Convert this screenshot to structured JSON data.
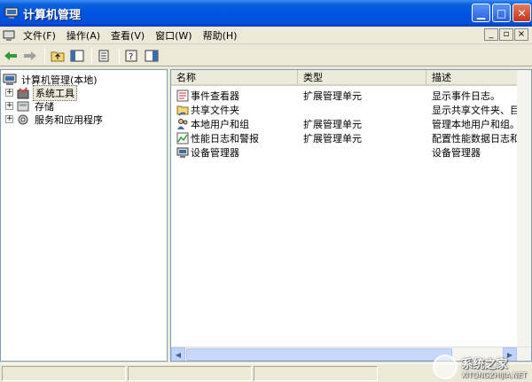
{
  "window": {
    "title": "计算机管理"
  },
  "menu": [
    "文件(F)",
    "操作(A)",
    "查看(V)",
    "窗口(W)",
    "帮助(H)"
  ],
  "mdi_controls": [
    "_",
    "▫",
    "×"
  ],
  "tree": {
    "root": "计算机管理(本地)",
    "items": [
      "系统工具",
      "存储",
      "服务和应用程序"
    ]
  },
  "list": {
    "headers": [
      "名称",
      "类型",
      "描述"
    ],
    "rows": [
      {
        "name": "事件查看器",
        "type": "扩展管理单元",
        "desc": "显示事件日志。"
      },
      {
        "name": "共享文件夹",
        "type": "",
        "desc": "显示共享文件夹、目前"
      },
      {
        "name": "本地用户和组",
        "type": "扩展管理单元",
        "desc": "管理本地用户和组。"
      },
      {
        "name": "性能日志和警报",
        "type": "扩展管理单元",
        "desc": "配置性能数据日志和警"
      },
      {
        "name": "设备管理器",
        "type": "",
        "desc": "设备管理器"
      }
    ]
  },
  "watermark": {
    "text": "系统之家",
    "sub": "XITONGZHIJIA.NET"
  }
}
